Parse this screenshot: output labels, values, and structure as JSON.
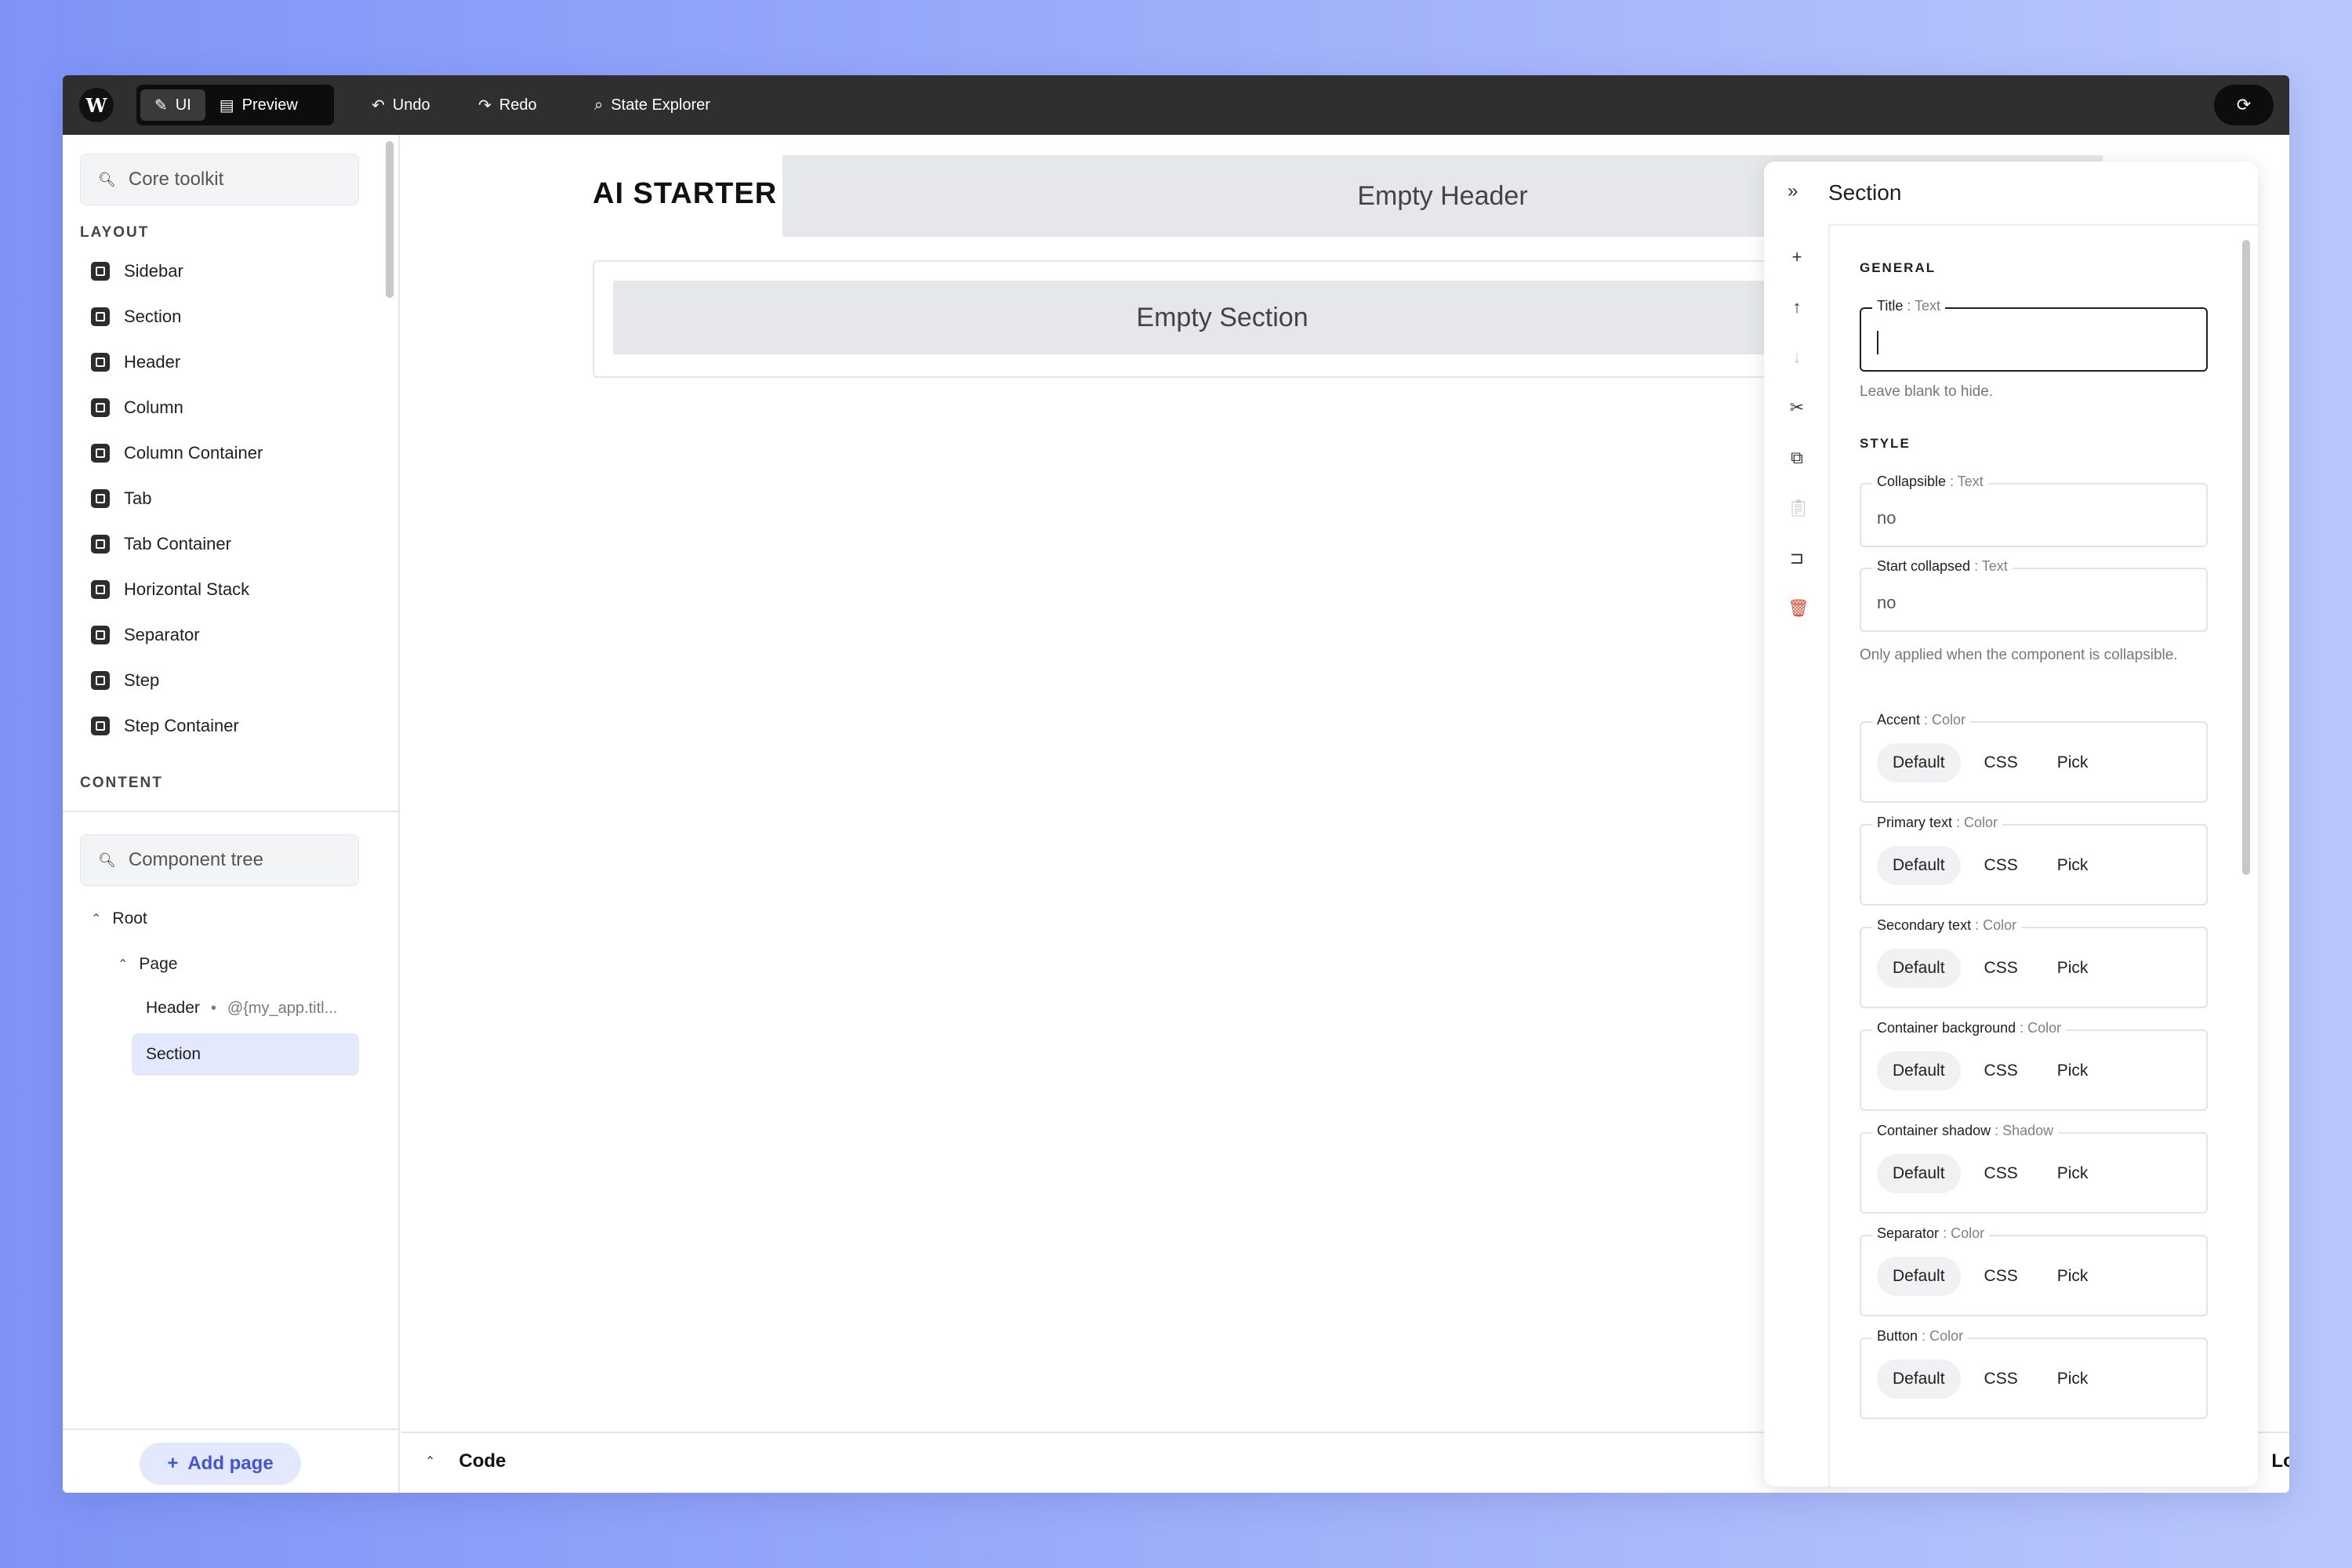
{
  "toolbar": {
    "logo": "W",
    "mode_ui": "UI",
    "mode_preview": "Preview",
    "undo": "Undo",
    "redo": "Redo",
    "state_explorer": "State Explorer",
    "sync_icon": "sync-icon"
  },
  "left": {
    "toolkit_search_placeholder": "Core toolkit",
    "layout_label": "LAYOUT",
    "layout_items": [
      "Sidebar",
      "Section",
      "Header",
      "Column",
      "Column Container",
      "Tab",
      "Tab Container",
      "Horizontal Stack",
      "Separator",
      "Step",
      "Step Container"
    ],
    "content_label": "CONTENT",
    "tree_search_placeholder": "Component tree",
    "tree": {
      "root": "Root",
      "page": "Page",
      "header": "Header",
      "header_meta": "@{my_app.titl...",
      "section": "Section"
    },
    "add_page": "Add page"
  },
  "canvas": {
    "app_title": "AI STARTER",
    "empty_header": "Empty Header",
    "empty_section": "Empty Section"
  },
  "bottom": {
    "code": "Code",
    "log": "Log"
  },
  "settings": {
    "title": "Section",
    "general_label": "GENERAL",
    "title_field": {
      "label": "Title",
      "type": ": Text",
      "value": ""
    },
    "title_hint": "Leave blank to hide.",
    "style_label": "STYLE",
    "collapsible": {
      "label": "Collapsible",
      "type": ": Text",
      "value": "no"
    },
    "start_collapsed": {
      "label": "Start collapsed",
      "type": ": Text",
      "value": "no"
    },
    "collapsed_hint": "Only applied when the component is collapsible.",
    "color_fields": [
      {
        "label": "Accent",
        "type": ": Color"
      },
      {
        "label": "Primary text",
        "type": ": Color"
      },
      {
        "label": "Secondary text",
        "type": ": Color"
      },
      {
        "label": "Container background",
        "type": ": Color"
      },
      {
        "label": "Container shadow",
        "type": ": Shadow"
      },
      {
        "label": "Separator",
        "type": ": Color"
      },
      {
        "label": "Button",
        "type": ": Color"
      }
    ],
    "options": {
      "default": "Default",
      "css": "CSS",
      "pick": "Pick"
    }
  }
}
